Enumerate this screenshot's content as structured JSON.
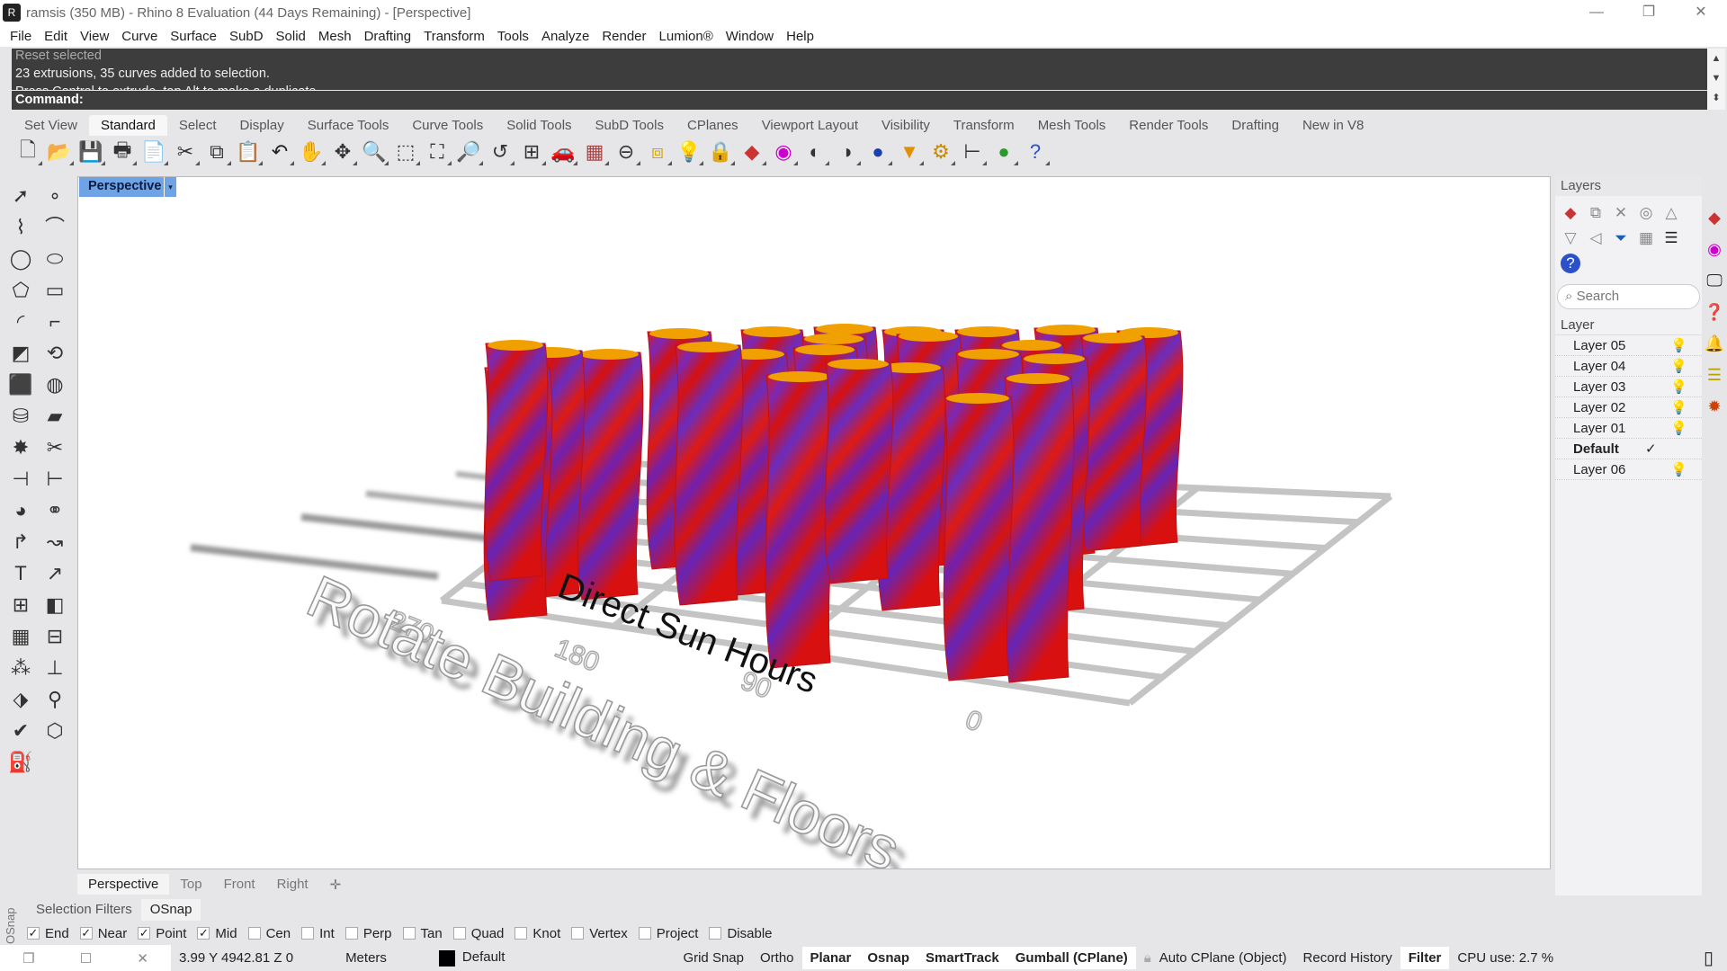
{
  "window": {
    "title": "ramsis (350 MB) - Rhino 8 Evaluation (44 Days Remaining) - [Perspective]",
    "minimize": "—",
    "restore": "❐",
    "close": "✕"
  },
  "menu": [
    "File",
    "Edit",
    "View",
    "Curve",
    "Surface",
    "SubD",
    "Solid",
    "Mesh",
    "Drafting",
    "Transform",
    "Tools",
    "Analyze",
    "Render",
    "Lumion®",
    "Window",
    "Help"
  ],
  "command": {
    "history": [
      "Reset selected",
      "23 extrusions, 35 curves added to selection.",
      "Press Control to extrude, tap Alt to make a duplicate"
    ],
    "prompt": "Command:"
  },
  "toolbar_tabs": [
    "Set View",
    "Standard",
    "Select",
    "Display",
    "Surface Tools",
    "Curve Tools",
    "Solid Tools",
    "SubD Tools",
    "CPlanes",
    "Viewport Layout",
    "Visibility",
    "Transform",
    "Mesh Tools",
    "Render Tools",
    "Drafting",
    "New in V8"
  ],
  "toolbar_active": "Standard",
  "toolbar_icons": [
    [
      "new-file-icon",
      "🗋",
      "#333"
    ],
    [
      "open-folder-icon",
      "📂",
      "#d9a400"
    ],
    [
      "save-icon",
      "💾",
      "#6b6b3a"
    ],
    [
      "print-icon",
      "🖶",
      "#333"
    ],
    [
      "export-icon",
      "📄",
      "#333"
    ],
    [
      "cut-icon",
      "✂",
      "#333"
    ],
    [
      "copy-icon",
      "⧉",
      "#333"
    ],
    [
      "paste-icon",
      "📋",
      "#c9a000"
    ],
    [
      "undo-icon",
      "↶",
      "#222"
    ],
    [
      "pan-hand-icon",
      "✋",
      "#333"
    ],
    [
      "rotate-view-icon",
      "✥",
      "#333"
    ],
    [
      "zoom-icon",
      "🔍",
      "#333"
    ],
    [
      "zoom-window-icon",
      "⬚",
      "#333"
    ],
    [
      "zoom-extents-icon",
      "⛶",
      "#333"
    ],
    [
      "zoom-selected-icon",
      "🔎",
      "#b8a000"
    ],
    [
      "undo-view-icon",
      "↺",
      "#333"
    ],
    [
      "four-viewports-icon",
      "⊞",
      "#333"
    ],
    [
      "car-icon",
      "🚗",
      "#d00"
    ],
    [
      "grid-icon",
      "▦",
      "#a44"
    ],
    [
      "cplane-icon",
      "⊖",
      "#333"
    ],
    [
      "object-snap-icon",
      "⧈",
      "#d9a400"
    ],
    [
      "light-bulb-icon",
      "💡",
      "#555"
    ],
    [
      "lock-icon",
      "🔒",
      "#333"
    ],
    [
      "layers-icon",
      "◆",
      "#c33"
    ],
    [
      "color-wheel-icon",
      "◉",
      "#c0c"
    ],
    [
      "shaded-sphere-icon",
      "◐",
      "#333"
    ],
    [
      "rendered-sphere-icon",
      "◑",
      "#333"
    ],
    [
      "render-sphere-icon",
      "●",
      "#1a3fb0"
    ],
    [
      "properties-icon",
      "▼",
      "#e09000"
    ],
    [
      "settings-gear-icon",
      "⚙",
      "#c98a00"
    ],
    [
      "dimension-icon",
      "⊢",
      "#333"
    ],
    [
      "grasshopper-icon",
      "●",
      "#2a9a2a"
    ],
    [
      "help-icon",
      "?",
      "#2b50c8"
    ]
  ],
  "palette_icons": [
    "select-arrow-icon",
    "point-icon",
    "polyline-icon",
    "curve-icon",
    "circle-icon",
    "ellipse-icon",
    "polygon-icon",
    "rectangle-icon",
    "arc-icon",
    "fillet-curve-icon",
    "surface-icon",
    "revolve-icon",
    "box-icon",
    "sphere-icon",
    "cylinder-icon",
    "plane-surface-icon",
    "explode-icon",
    "split-icon",
    "trim-icon",
    "extend-icon",
    "boolean-union-icon",
    "boolean-split-icon",
    "offset-icon",
    "blend-icon",
    "text-icon",
    "dimension-icon",
    "array-icon",
    "mirror-icon",
    "block-icon",
    "layout-icon",
    "grid-array-icon",
    "gumball-icon",
    "analyze-icon",
    "transform-icon",
    "check-icon",
    "mesh-icon",
    "paint-icon"
  ],
  "palette_glyphs": [
    "➚",
    "∘",
    "⌇",
    "⌒",
    "◯",
    "⬭",
    "⬠",
    "▭",
    "◜",
    "⌐",
    "◩",
    "⟲",
    "⬛",
    "◍",
    "⛁",
    "▰",
    "✸",
    "✂",
    "⊣",
    "⊢",
    "◕",
    "⚭",
    "↱",
    "↝",
    "T",
    "↗",
    "⊞",
    "◧",
    "▦",
    "⊟",
    "⁂",
    "⊥",
    "⬗",
    "⚲",
    "✔",
    "⬡",
    "⛽"
  ],
  "viewport": {
    "name": "Perspective",
    "menu_arrow": "▾",
    "scene": {
      "axis_title": "Direct Sun Hours",
      "tick_labels": [
        "270",
        "180",
        "90",
        "0"
      ],
      "title_3d": "Rotate Building & Floors"
    }
  },
  "viewport_tabs": [
    "Perspective",
    "Top",
    "Front",
    "Right"
  ],
  "viewport_add": "✛",
  "layers": {
    "title": "Layers",
    "search_placeholder": "Search",
    "column": "Layer",
    "rows": [
      {
        "name": "Layer 05",
        "current": false
      },
      {
        "name": "Layer 04",
        "current": false
      },
      {
        "name": "Layer 03",
        "current": false
      },
      {
        "name": "Layer 02",
        "current": false
      },
      {
        "name": "Layer 01",
        "current": false
      },
      {
        "name": "Default",
        "current": true
      },
      {
        "name": "Layer 06",
        "current": false
      }
    ],
    "current_mark": "✓",
    "bulb": "💡"
  },
  "osnap": {
    "side_label": "OSnap",
    "tabs": [
      "Selection Filters",
      "OSnap"
    ],
    "active": "OSnap",
    "options": [
      {
        "label": "End",
        "checked": true
      },
      {
        "label": "Near",
        "checked": true
      },
      {
        "label": "Point",
        "checked": true
      },
      {
        "label": "Mid",
        "checked": true
      },
      {
        "label": "Cen",
        "checked": false
      },
      {
        "label": "Int",
        "checked": false
      },
      {
        "label": "Perp",
        "checked": false
      },
      {
        "label": "Tan",
        "checked": false
      },
      {
        "label": "Quad",
        "checked": false
      },
      {
        "label": "Knot",
        "checked": false
      },
      {
        "label": "Vertex",
        "checked": false
      },
      {
        "label": "Project",
        "checked": false
      },
      {
        "label": "Disable",
        "checked": false
      }
    ]
  },
  "status": {
    "coords": "3.99 Y 4942.81 Z 0",
    "units": "Meters",
    "layer": "Default",
    "layer_color": "#000000",
    "grid_snap": "Grid Snap",
    "ortho": "Ortho",
    "planar": "Planar",
    "osnap": "Osnap",
    "smarttrack": "SmartTrack",
    "gumball": "Gumball (CPlane)",
    "auto_cplane": "Auto CPlane (Object)",
    "record_history": "Record History",
    "filter": "Filter",
    "cpu": "CPU use: 2.7 %"
  }
}
